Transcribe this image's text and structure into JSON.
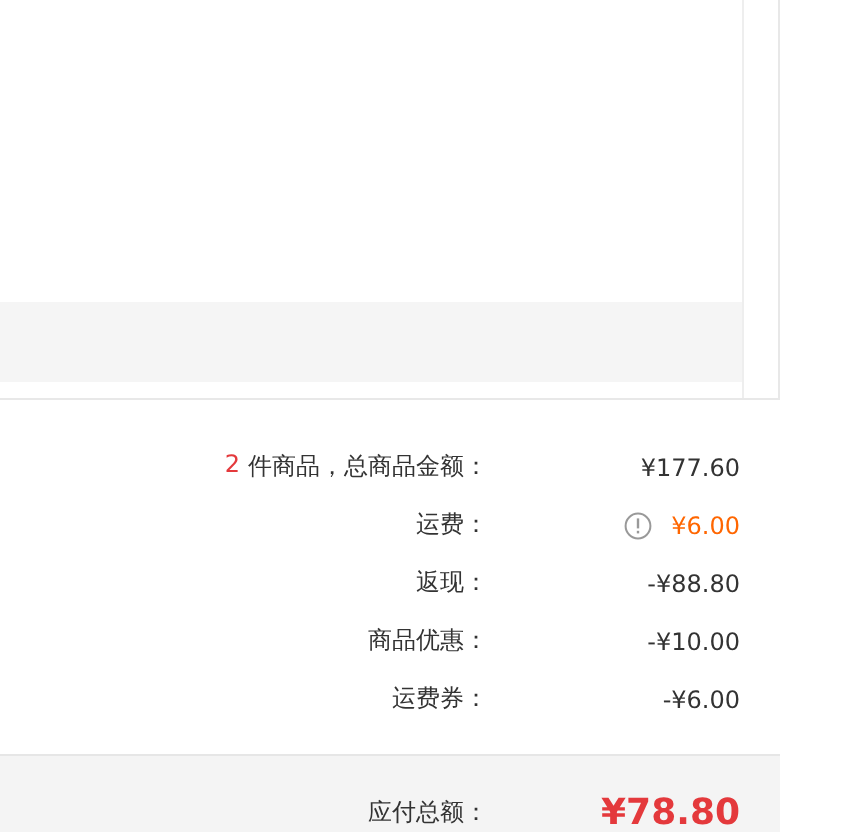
{
  "summary": [
    {
      "kind": "count",
      "count": "2",
      "label": "件商品，总商品金额：",
      "value": "¥177.60"
    },
    {
      "kind": "notice",
      "label": "运费：",
      "value": "¥6.00"
    },
    {
      "kind": "plain",
      "label": "返现：",
      "value": "-¥88.80"
    },
    {
      "kind": "plain",
      "label": "商品优惠：",
      "value": "-¥10.00"
    },
    {
      "kind": "plain",
      "label": "运费券：",
      "value": "-¥6.00"
    }
  ],
  "total": {
    "label": "应付总额：",
    "value": "¥78.80"
  }
}
